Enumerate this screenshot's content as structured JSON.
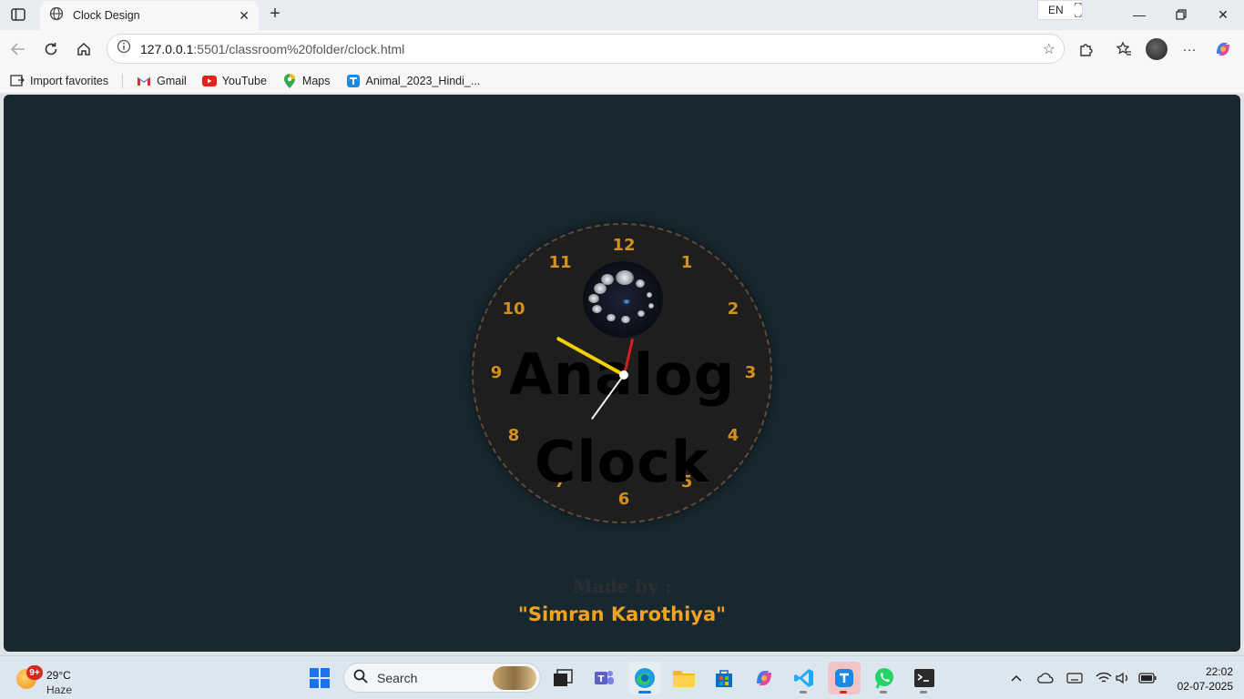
{
  "browser": {
    "tab_title": "Clock Design",
    "url_host": "127.0.0.1",
    "url_path": ":5501/classroom%20folder/clock.html",
    "lang": "EN",
    "favorites": [
      {
        "label": "Import favorites",
        "icon": "import-icon"
      },
      {
        "label": "Gmail",
        "icon": "gmail-icon"
      },
      {
        "label": "YouTube",
        "icon": "youtube-icon"
      },
      {
        "label": "Maps",
        "icon": "maps-icon"
      },
      {
        "label": "Animal_2023_Hindi_...",
        "icon": "site-icon"
      }
    ]
  },
  "clock": {
    "numbers": [
      "12",
      "1",
      "2",
      "3",
      "4",
      "5",
      "6",
      "7",
      "8",
      "9",
      "10",
      "11"
    ],
    "title_line1": "Analog",
    "title_line2": "Clock",
    "colors": {
      "hour_hand": "#f0d000",
      "minute_hand": "#d11e1e",
      "second_hand": "#f2f2f2",
      "numbers": "#d4901c"
    }
  },
  "footer": {
    "made_by": "Made by :",
    "author": "\"Simran Karothiya\""
  },
  "taskbar": {
    "weather_badge": "9+",
    "temperature": "29°C",
    "condition": "Haze",
    "search_placeholder": "Search",
    "time": "22:02",
    "date": "02-07-2025"
  }
}
